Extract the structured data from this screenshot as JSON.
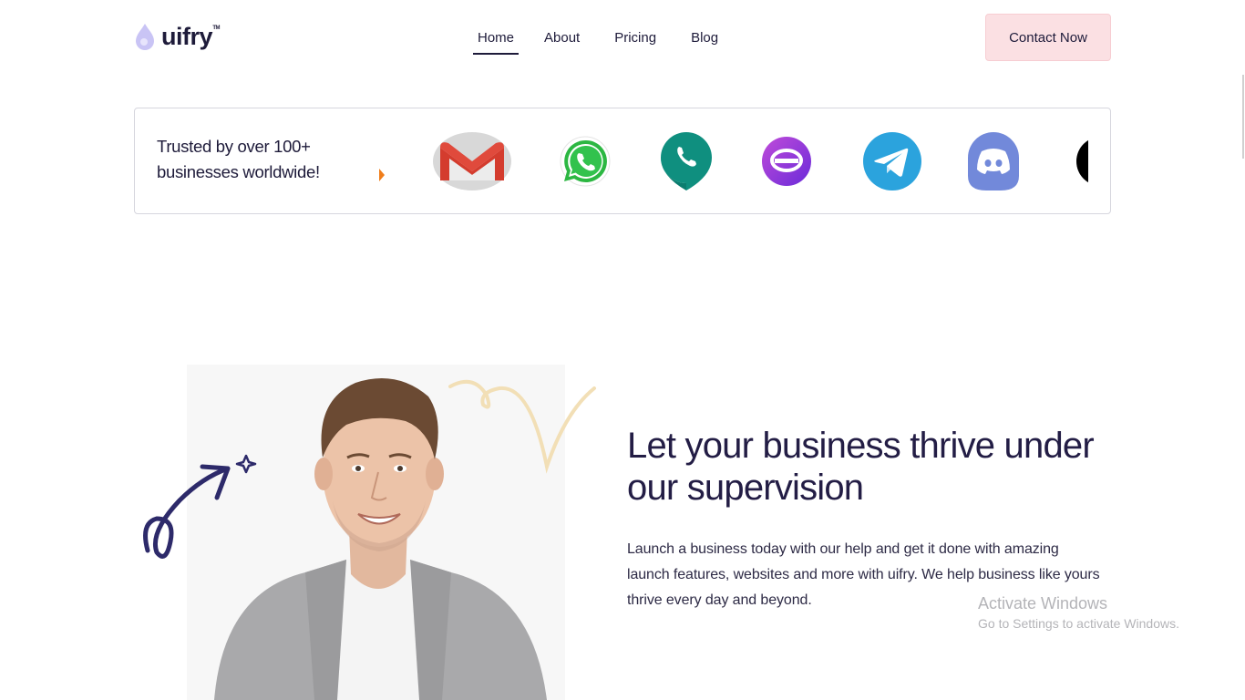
{
  "brand": {
    "name": "uifry",
    "trademark": "TM",
    "accent": "#c9c4f5"
  },
  "nav": {
    "items": [
      {
        "label": "Home",
        "active": true
      },
      {
        "label": "About",
        "active": false
      },
      {
        "label": "Pricing",
        "active": false
      },
      {
        "label": "Blog",
        "active": false
      }
    ]
  },
  "header": {
    "cta_label": "Contact Now",
    "cta_color": "#fbe0e3"
  },
  "trusted": {
    "text": "Trusted by over 100+ businesses worldwide!",
    "logos": [
      "gmail-logo",
      "whatsapp-logo",
      "google-voice-logo",
      "textnow-logo",
      "telegram-logo",
      "discord-logo",
      "partial-logo"
    ]
  },
  "hero": {
    "heading": "Let your business thrive under our supervision",
    "description": "Launch a business today with our help and get it done with amazing launch features, websites and more with uifry. We help business like yours thrive every day and beyond."
  },
  "watermark": {
    "title": "Activate Windows",
    "subtitle": "Go to Settings to activate Windows."
  }
}
